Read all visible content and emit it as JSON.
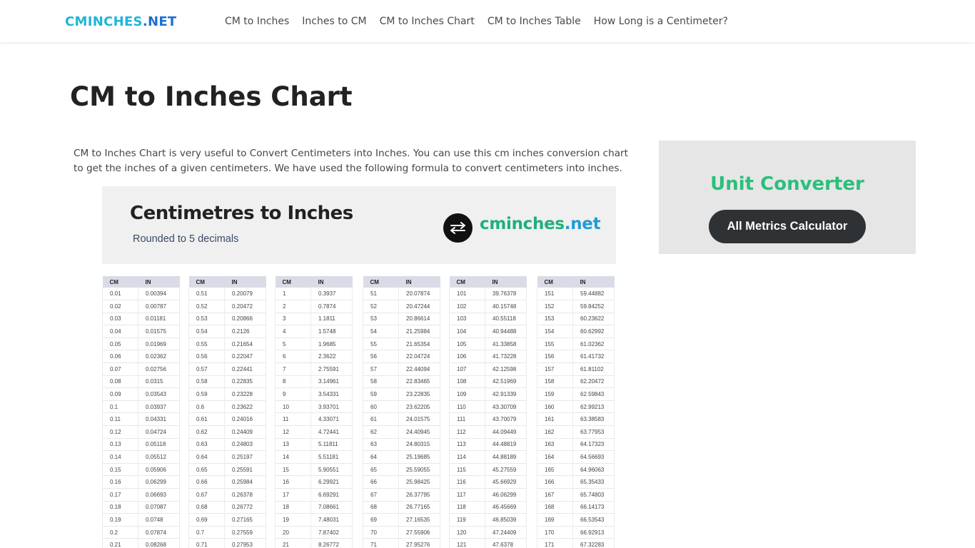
{
  "header": {
    "logo_part1": "CMINCHES",
    "logo_part2": ".NET",
    "nav": [
      "CM to Inches",
      "Inches to CM",
      "CM to Inches Chart",
      "CM to Inches Table",
      "How Long is a Centimeter?"
    ]
  },
  "page": {
    "title": "CM to Inches Chart",
    "intro": "CM to Inches Chart is very useful to Convert Centimeters into Inches. You can use this cm inches conversion chart to get the inches of a given centimeters. We have used the following formula to convert centimeters into inches."
  },
  "banner": {
    "title": "Centimetres to Inches",
    "subtitle": "Rounded to 5 decimals",
    "brand_part1": "cminches",
    "brand_part2": ".net",
    "icon": "swap-arrows-icon"
  },
  "conversion_table": {
    "headers": [
      "CM",
      "IN"
    ],
    "columns": [
      [
        [
          "0.01",
          "0.00394"
        ],
        [
          "0.02",
          "0.00787"
        ],
        [
          "0.03",
          "0.01181"
        ],
        [
          "0.04",
          "0.01575"
        ],
        [
          "0.05",
          "0.01969"
        ],
        [
          "0.06",
          "0.02362"
        ],
        [
          "0.07",
          "0.02756"
        ],
        [
          "0.08",
          "0.0315"
        ],
        [
          "0.09",
          "0.03543"
        ],
        [
          "0.1",
          "0.03937"
        ],
        [
          "0.11",
          "0.04331"
        ],
        [
          "0.12",
          "0.04724"
        ],
        [
          "0.13",
          "0.05118"
        ],
        [
          "0.14",
          "0.05512"
        ],
        [
          "0.15",
          "0.05906"
        ],
        [
          "0.16",
          "0.06299"
        ],
        [
          "0.17",
          "0.06693"
        ],
        [
          "0.18",
          "0.07087"
        ],
        [
          "0.19",
          "0.0748"
        ],
        [
          "0.2",
          "0.07874"
        ],
        [
          "0.21",
          "0.08268"
        ]
      ],
      [
        [
          "0.51",
          "0.20079"
        ],
        [
          "0.52",
          "0.20472"
        ],
        [
          "0.53",
          "0.20866"
        ],
        [
          "0.54",
          "0.2126"
        ],
        [
          "0.55",
          "0.21654"
        ],
        [
          "0.56",
          "0.22047"
        ],
        [
          "0.57",
          "0.22441"
        ],
        [
          "0.58",
          "0.22835"
        ],
        [
          "0.59",
          "0.23228"
        ],
        [
          "0.6",
          "0.23622"
        ],
        [
          "0.61",
          "0.24016"
        ],
        [
          "0.62",
          "0.24409"
        ],
        [
          "0.63",
          "0.24803"
        ],
        [
          "0.64",
          "0.25197"
        ],
        [
          "0.65",
          "0.25591"
        ],
        [
          "0.66",
          "0.25984"
        ],
        [
          "0.67",
          "0.26378"
        ],
        [
          "0.68",
          "0.26772"
        ],
        [
          "0.69",
          "0.27165"
        ],
        [
          "0.7",
          "0.27559"
        ],
        [
          "0.71",
          "0.27953"
        ]
      ],
      [
        [
          "1",
          "0.3937"
        ],
        [
          "2",
          "0.7874"
        ],
        [
          "3",
          "1.1811"
        ],
        [
          "4",
          "1.5748"
        ],
        [
          "5",
          "1.9685"
        ],
        [
          "6",
          "2.3622"
        ],
        [
          "7",
          "2.75591"
        ],
        [
          "8",
          "3.14961"
        ],
        [
          "9",
          "3.54331"
        ],
        [
          "10",
          "3.93701"
        ],
        [
          "11",
          "4.33071"
        ],
        [
          "12",
          "4.72441"
        ],
        [
          "13",
          "5.11811"
        ],
        [
          "14",
          "5.51181"
        ],
        [
          "15",
          "5.90551"
        ],
        [
          "16",
          "6.29921"
        ],
        [
          "17",
          "6.69291"
        ],
        [
          "18",
          "7.08661"
        ],
        [
          "19",
          "7.48031"
        ],
        [
          "20",
          "7.87402"
        ],
        [
          "21",
          "8.26772"
        ]
      ],
      [
        [
          "51",
          "20.07874"
        ],
        [
          "52",
          "20.47244"
        ],
        [
          "53",
          "20.86614"
        ],
        [
          "54",
          "21.25984"
        ],
        [
          "55",
          "21.65354"
        ],
        [
          "56",
          "22.04724"
        ],
        [
          "57",
          "22.44094"
        ],
        [
          "58",
          "22.83465"
        ],
        [
          "59",
          "23.22835"
        ],
        [
          "60",
          "23.62205"
        ],
        [
          "61",
          "24.01575"
        ],
        [
          "62",
          "24.40945"
        ],
        [
          "63",
          "24.80315"
        ],
        [
          "64",
          "25.19685"
        ],
        [
          "65",
          "25.59055"
        ],
        [
          "66",
          "25.98425"
        ],
        [
          "67",
          "26.37795"
        ],
        [
          "68",
          "26.77165"
        ],
        [
          "69",
          "27.16535"
        ],
        [
          "70",
          "27.55906"
        ],
        [
          "71",
          "27.95276"
        ]
      ],
      [
        [
          "101",
          "39.76378"
        ],
        [
          "102",
          "40.15748"
        ],
        [
          "103",
          "40.55118"
        ],
        [
          "104",
          "40.94488"
        ],
        [
          "105",
          "41.33858"
        ],
        [
          "106",
          "41.73228"
        ],
        [
          "107",
          "42.12598"
        ],
        [
          "108",
          "42.51969"
        ],
        [
          "109",
          "42.91339"
        ],
        [
          "110",
          "43.30709"
        ],
        [
          "111",
          "43.70079"
        ],
        [
          "112",
          "44.09449"
        ],
        [
          "113",
          "44.48819"
        ],
        [
          "114",
          "44.88189"
        ],
        [
          "115",
          "45.27559"
        ],
        [
          "116",
          "45.66929"
        ],
        [
          "117",
          "46.06299"
        ],
        [
          "118",
          "46.45669"
        ],
        [
          "119",
          "46.85039"
        ],
        [
          "120",
          "47.24409"
        ],
        [
          "121",
          "47.6378"
        ]
      ],
      [
        [
          "151",
          "59.44882"
        ],
        [
          "152",
          "59.84252"
        ],
        [
          "153",
          "60.23622"
        ],
        [
          "154",
          "60.62992"
        ],
        [
          "155",
          "61.02362"
        ],
        [
          "156",
          "61.41732"
        ],
        [
          "157",
          "61.81102"
        ],
        [
          "158",
          "62.20472"
        ],
        [
          "159",
          "62.59843"
        ],
        [
          "160",
          "62.99213"
        ],
        [
          "161",
          "63.38583"
        ],
        [
          "162",
          "63.77953"
        ],
        [
          "163",
          "64.17323"
        ],
        [
          "164",
          "64.56693"
        ],
        [
          "165",
          "64.96063"
        ],
        [
          "166",
          "65.35433"
        ],
        [
          "167",
          "65.74803"
        ],
        [
          "168",
          "66.14173"
        ],
        [
          "169",
          "66.53543"
        ],
        [
          "170",
          "66.92913"
        ],
        [
          "171",
          "67.32283"
        ]
      ]
    ]
  },
  "sidebar": {
    "title": "Unit Converter",
    "button_label": "All Metrics Calculator"
  },
  "colors": {
    "logo_light": "#1fb5d8",
    "logo_dark": "#1d6fcf",
    "brand_green": "#1fb07a",
    "sidebar_title": "#2bbf7b",
    "button_bg": "#2f3235"
  }
}
